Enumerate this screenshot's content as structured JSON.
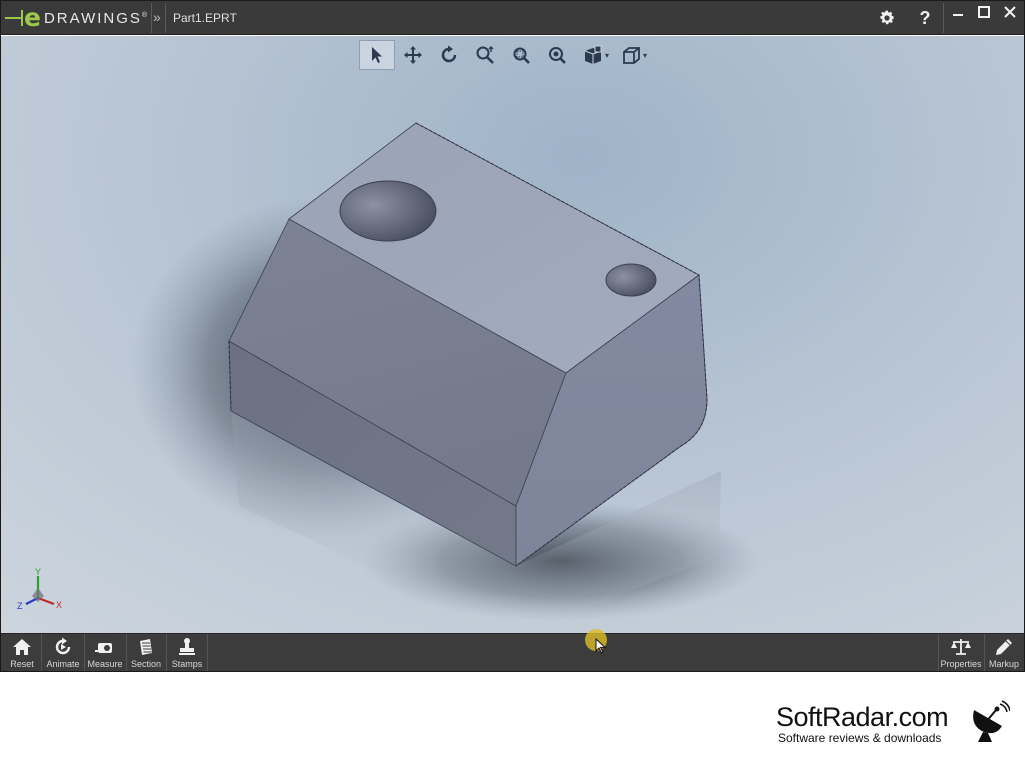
{
  "app": {
    "logo_letter": "e",
    "logo_word": "DRAWINGS",
    "logo_mark": "®",
    "breadcrumb_chevron": "»",
    "file_name": "Part1.EPRT",
    "header_icons": [
      "gear-icon",
      "help-icon"
    ],
    "help_label": "?",
    "window_controls": [
      "minimize-icon",
      "maximize-icon",
      "close-icon"
    ]
  },
  "view_toolbar": {
    "tools": [
      "select-icon",
      "pan-icon",
      "rotate-icon",
      "zoom-icon",
      "zoom-to-area-icon",
      "zoom-to-fit-icon",
      "display-style-icon",
      "view-orientation-icon"
    ],
    "active_tool": "select-icon"
  },
  "triad": {
    "x": "X",
    "y": "Y",
    "z": "Z"
  },
  "bottom_toolbar": {
    "left": [
      {
        "label": "Reset",
        "icon": "home-icon"
      },
      {
        "label": "Animate",
        "icon": "animate-icon"
      },
      {
        "label": "Measure",
        "icon": "measure-icon"
      },
      {
        "label": "Section",
        "icon": "section-icon"
      },
      {
        "label": "Stamps",
        "icon": "stamp-icon"
      }
    ],
    "right": [
      {
        "label": "Properties",
        "icon": "scale-icon"
      },
      {
        "label": "Markup",
        "icon": "pencil-icon"
      }
    ]
  },
  "watermark": {
    "title": "SoftRadar.com",
    "subtitle": "Software reviews & downloads"
  },
  "colors": {
    "brand_green": "#9ac848",
    "titlebar": "#3a3a3a",
    "viewport_top": "#9fb3c8",
    "viewport_bottom": "#cdd5de",
    "model_top_face": "#9ca4b5",
    "model_front_face": "#6f7585",
    "cursor_highlight": "#dcbe28"
  }
}
